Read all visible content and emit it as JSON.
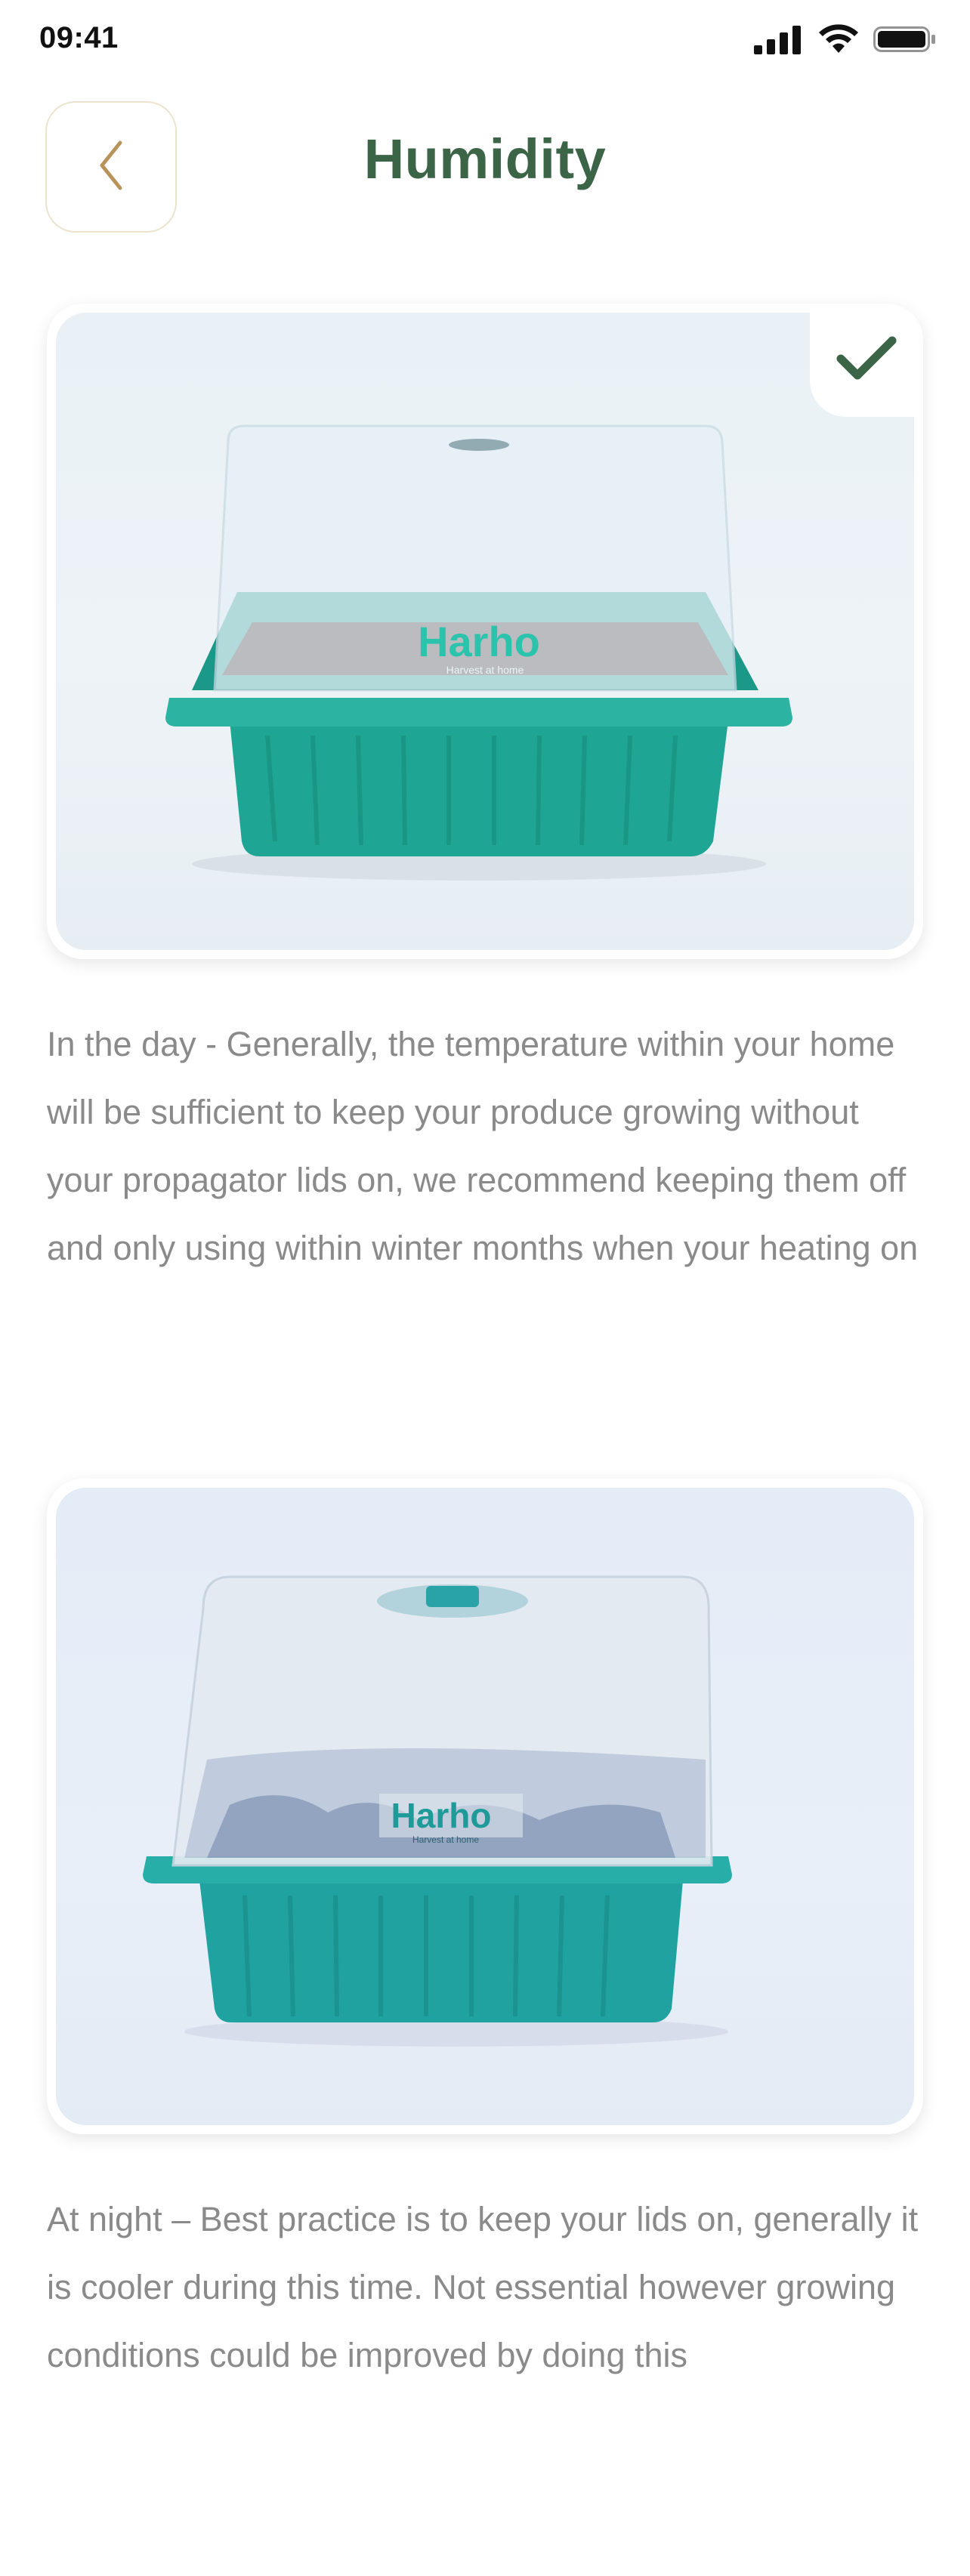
{
  "status_bar": {
    "time": "09:41",
    "icons": [
      "signal-icon",
      "wifi-icon",
      "battery-icon"
    ]
  },
  "header": {
    "back_icon": "chevron-left-icon",
    "title": "Humidity"
  },
  "sections": [
    {
      "image": {
        "subject": "seed propagator tray with clear lid",
        "brand_text": "Harho",
        "brand_tagline": "Harvest at home",
        "selected": true,
        "badge_icon": "checkmark-icon"
      },
      "text": "In the day - Generally, the temperature within your home will be sufficient to keep your produce growing without your propagator lids on, we recommend keeping them off and only using within winter months when your heating on"
    },
    {
      "image": {
        "subject": "seed propagator tray with misted lid",
        "brand_text": "Harho",
        "brand_tagline": "Harvest at home",
        "selected": false
      },
      "text": "At night – Best practice is to keep your lids on, generally it is cooler during this time. Not essential however growing conditions could be improved by doing this"
    }
  ],
  "colors": {
    "title": "#3c6447",
    "back_chevron": "#b8935a",
    "back_border": "#ece3cc",
    "check": "#3c6447",
    "body_text": "#8a8a8a",
    "tray": "#1fa593"
  }
}
